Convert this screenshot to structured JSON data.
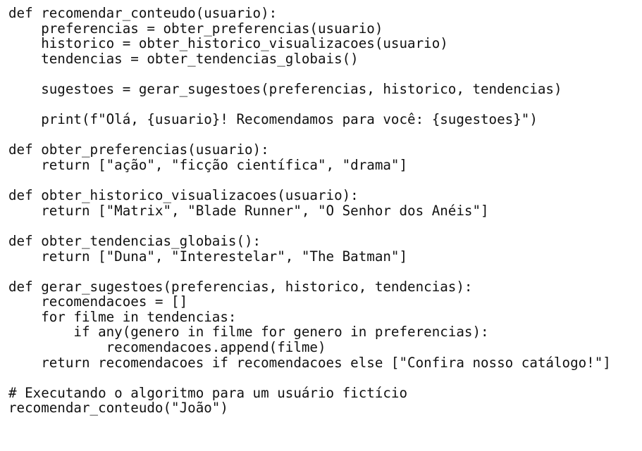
{
  "code_lines": [
    "def recomendar_conteudo(usuario):",
    "    preferencias = obter_preferencias(usuario)",
    "    historico = obter_historico_visualizacoes(usuario)",
    "    tendencias = obter_tendencias_globais()",
    "",
    "    sugestoes = gerar_sugestoes(preferencias, historico, tendencias)",
    "",
    "    print(f\"Olá, {usuario}! Recomendamos para você: {sugestoes}\")",
    "",
    "def obter_preferencias(usuario):",
    "    return [\"ação\", \"ficção científica\", \"drama\"]",
    "",
    "def obter_historico_visualizacoes(usuario):",
    "    return [\"Matrix\", \"Blade Runner\", \"O Senhor dos Anéis\"]",
    "",
    "def obter_tendencias_globais():",
    "    return [\"Duna\", \"Interestelar\", \"The Batman\"]",
    "",
    "def gerar_sugestoes(preferencias, historico, tendencias):",
    "    recomendacoes = []",
    "    for filme in tendencias:",
    "        if any(genero in filme for genero in preferencias):",
    "            recomendacoes.append(filme)",
    "    return recomendacoes if recomendacoes else [\"Confira nosso catálogo!\"]",
    "",
    "# Executando o algoritmo para um usuário fictício",
    "recomendar_conteudo(\"João\")"
  ]
}
